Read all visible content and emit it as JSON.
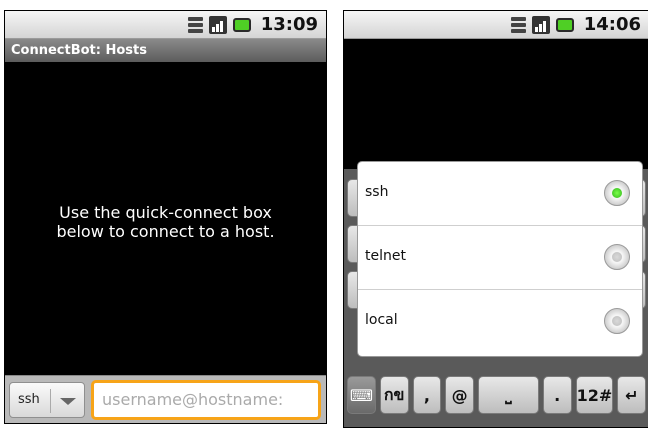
{
  "left_screen": {
    "status_time": "13:09",
    "title": "ConnectBot: Hosts",
    "empty_message_line1": "Use the quick-connect box",
    "empty_message_line2": "below to connect to a host.",
    "protocol_selected": "ssh",
    "host_input_placeholder": "username@hostname:"
  },
  "right_screen": {
    "status_time": "14:06",
    "protocol_options": [
      {
        "label": "ssh",
        "selected": true
      },
      {
        "label": "telnet",
        "selected": false
      },
      {
        "label": "local",
        "selected": false
      }
    ],
    "keyboard_bottom_keys": [
      "กข",
      ",",
      "@",
      "",
      ".",
      "12#",
      "↵"
    ]
  },
  "colors": {
    "input_focus_border": "#f7a418",
    "radio_selected": "#2fb51a",
    "battery": "#4fcf25"
  }
}
